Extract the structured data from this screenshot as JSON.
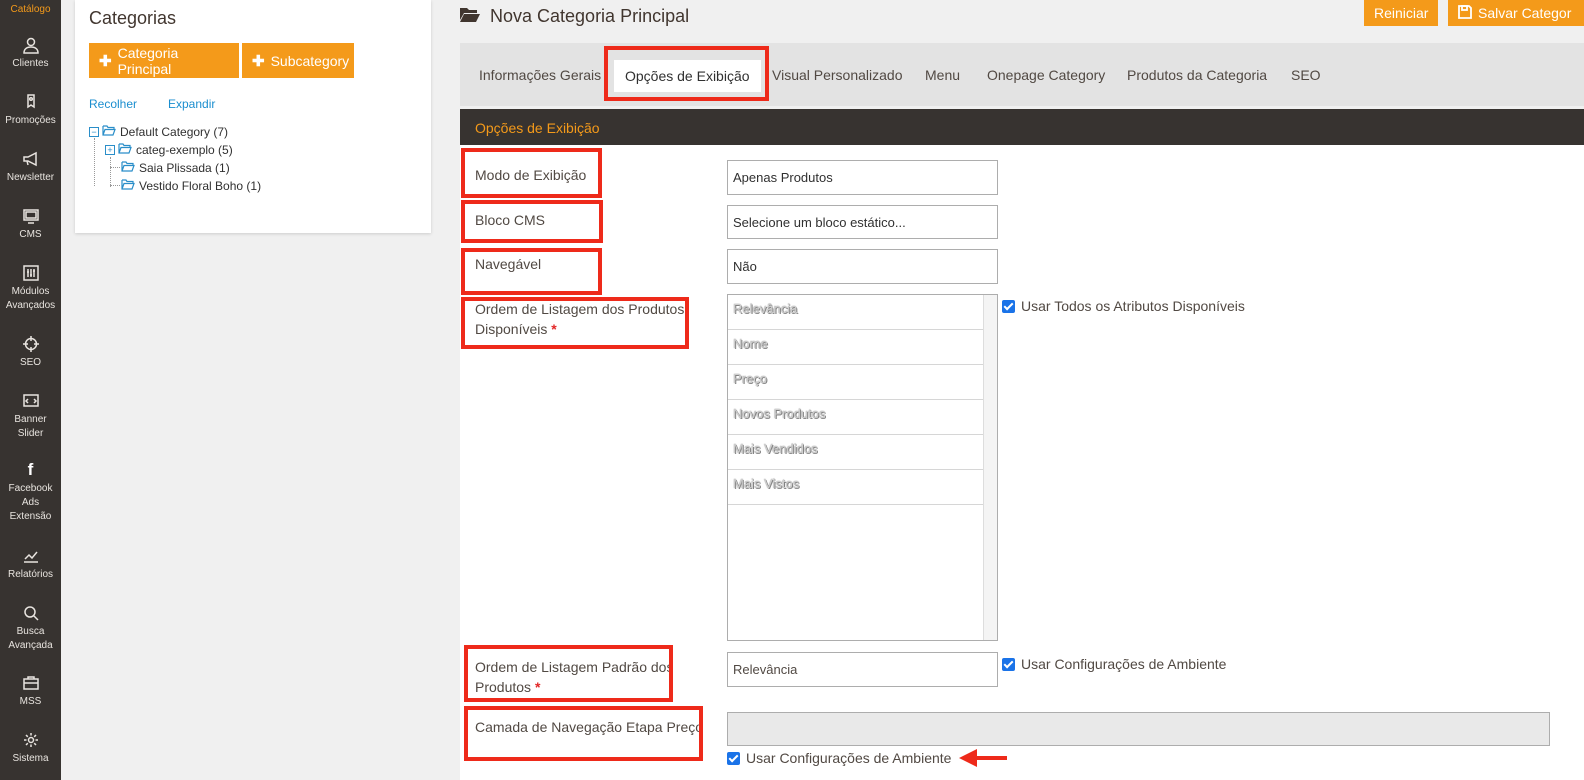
{
  "leftnav": {
    "items": [
      {
        "label": "Catálogo",
        "icon": "catalog-icon"
      },
      {
        "label": "Clientes",
        "icon": "user-icon"
      },
      {
        "label": "Promoções",
        "icon": "tag-icon"
      },
      {
        "label": "Newsletter",
        "icon": "megaphone-icon"
      },
      {
        "label": "CMS",
        "icon": "monitor-icon"
      },
      {
        "label": "Módulos",
        "label2": "Avançados",
        "icon": "sliders-icon"
      },
      {
        "label": "SEO",
        "icon": "crosshair-icon"
      },
      {
        "label": "Banner",
        "label2": "Slider",
        "icon": "banner-icon"
      },
      {
        "label": "Facebook",
        "label2": "Ads",
        "label3": "Extensão",
        "icon": "facebook-icon"
      },
      {
        "label": "Relatórios",
        "icon": "chart-icon"
      },
      {
        "label": "Busca",
        "label2": "Avançada",
        "icon": "search-icon"
      },
      {
        "label": "MSS",
        "icon": "briefcase-icon"
      },
      {
        "label": "Sistema",
        "icon": "gear-icon"
      }
    ]
  },
  "tree": {
    "title": "Categorias",
    "add_root": "Categoria Principal",
    "add_sub": "Subcategory",
    "collapse": "Recolher",
    "expand": "Expandir",
    "nodes": [
      "Default Category (7)",
      "categ-exemplo (5)",
      "Saia Plissada (1)",
      "Vestido Floral Boho (1)"
    ]
  },
  "header": {
    "title": "Nova Categoria Principal",
    "reset": "Reiniciar",
    "save": "Salvar Categor"
  },
  "tabs": [
    "Informações Gerais",
    "Opções de Exibição",
    "Visual Personalizado",
    "Menu",
    "Onepage Category",
    "Produtos da Categoria",
    "SEO"
  ],
  "section": {
    "title": "Opções de Exibição"
  },
  "fields": {
    "display_mode": {
      "label": "Modo de Exibição",
      "value": "Apenas Produtos"
    },
    "cms_block": {
      "label": "Bloco CMS",
      "value": "Selecione um bloco estático..."
    },
    "anchor": {
      "label": "Navegável",
      "value": "Não"
    },
    "sort_by": {
      "label": "Ordem de Listagem dos Produtos",
      "label2": "Disponíveis",
      "options": [
        "Relevância",
        "Nome",
        "Preço",
        "Novos Produtos",
        "Mais Vendidos",
        "Mais Vistos"
      ],
      "use_all": "Usar Todos os Atributos Disponíveis"
    },
    "default_sort": {
      "label": "Ordem de Listagem Padrão dos",
      "label2": "Produtos",
      "value": "Relevância",
      "use_config": "Usar Configurações de Ambiente"
    },
    "price_step": {
      "label": "Camada de Navegação Etapa Preço",
      "use_config": "Usar Configurações de Ambiente"
    }
  },
  "colors": {
    "accent": "#f49a1a",
    "nav_bg": "#373330",
    "annotation": "#ee2a1a"
  }
}
